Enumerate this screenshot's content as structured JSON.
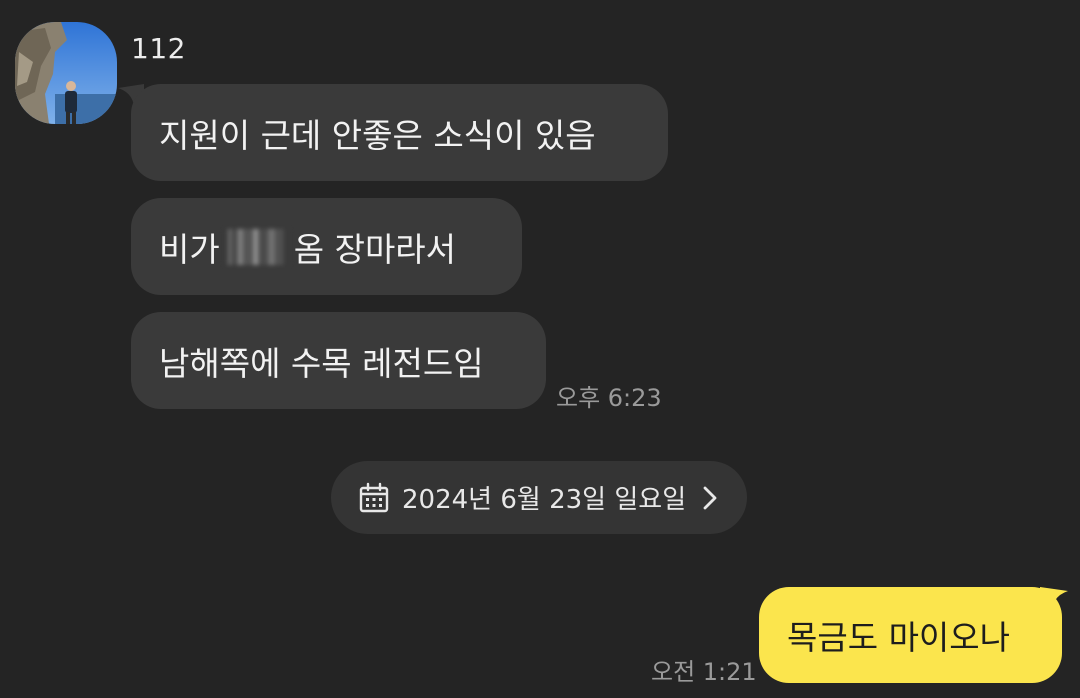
{
  "chat": {
    "sender_name": "112",
    "incoming": [
      {
        "text": "지원이 근데 안좋은 소식이 있음"
      },
      {
        "text_before": "비가",
        "text_after": "옴 장마라서"
      },
      {
        "text": "남해쪽에 수목 레전드임"
      }
    ],
    "incoming_time": "오후 6:23",
    "date_divider": "2024년 6월 23일 일요일",
    "outgoing": [
      {
        "text": "목금도 마이오나"
      }
    ],
    "outgoing_time": "오전 1:21"
  },
  "icons": {
    "date_divider_icon": "calendar-icon",
    "date_divider_arrow": "chevron-right-icon"
  },
  "colors": {
    "background": "#242424",
    "incoming_bubble": "#3a3a3a",
    "outgoing_bubble": "#fbe54d",
    "date_pill": "#343434",
    "timestamp": "#9a9a9a"
  }
}
